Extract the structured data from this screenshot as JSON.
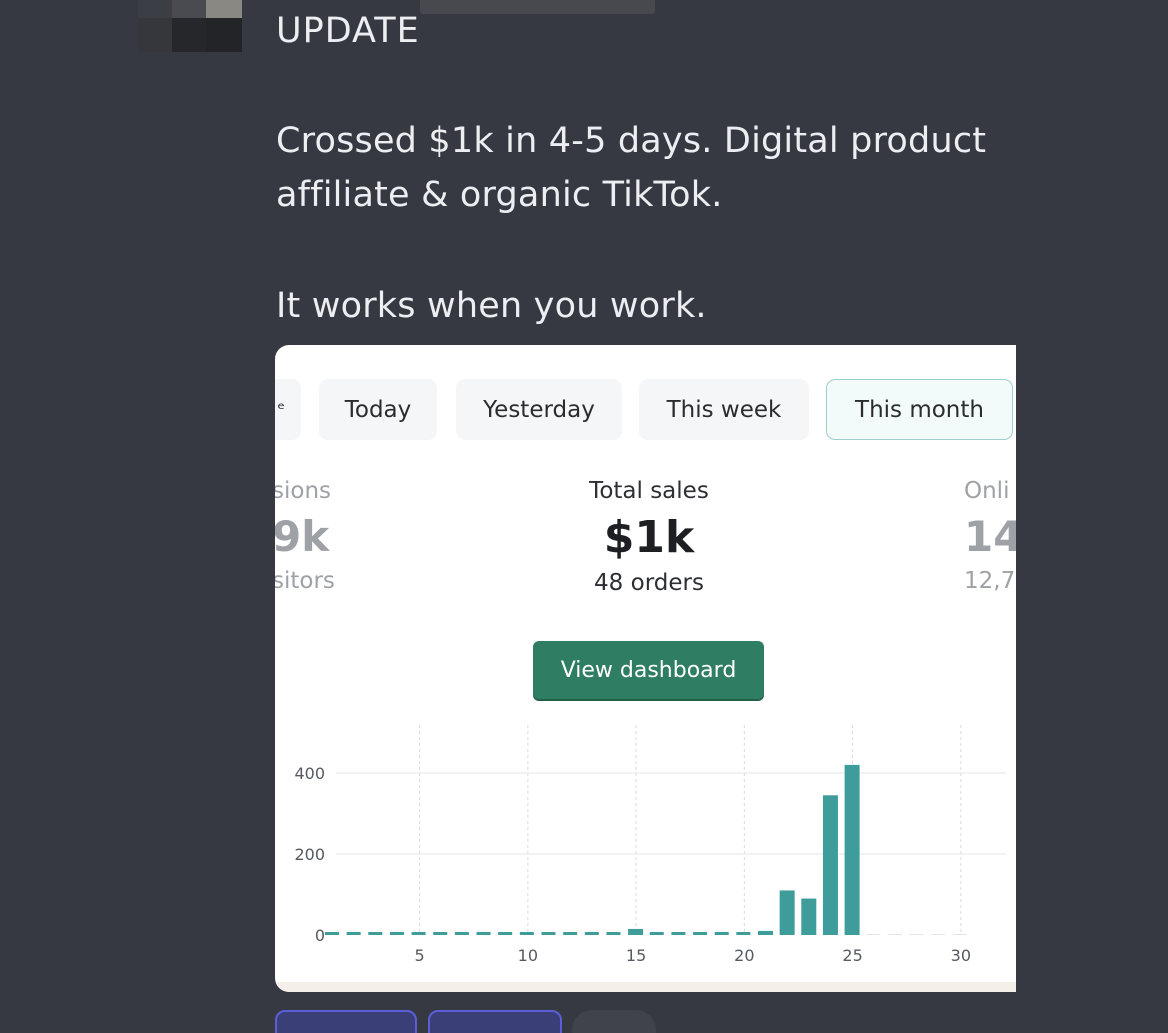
{
  "message": {
    "title": "UPDATE",
    "line1": "Crossed $1k in 4-5 days. Digital product",
    "line2": "affiliate & organic TikTok.",
    "line3": "It works when you work."
  },
  "card": {
    "tabs": [
      {
        "label": "Today"
      },
      {
        "label": "Yesterday"
      },
      {
        "label": "This week"
      },
      {
        "label": "This month",
        "active": true
      }
    ],
    "left_metric": {
      "label": "sions",
      "value": "9k",
      "sub": "sitors"
    },
    "center_metric": {
      "label": "Total sales",
      "value": "$1k",
      "sub": "48 orders"
    },
    "right_metric": {
      "label": "Onli",
      "value": "14",
      "sub": "12,7"
    },
    "dashboard_button": "View dashboard",
    "accent_color": "#2f7d62",
    "bar_color": "#3e9d9b"
  },
  "chart_data": {
    "type": "bar",
    "x": [
      1,
      2,
      3,
      4,
      5,
      6,
      7,
      8,
      9,
      10,
      11,
      12,
      13,
      14,
      15,
      16,
      17,
      18,
      19,
      20,
      21,
      22,
      23,
      24,
      25,
      26,
      27,
      28,
      29,
      30
    ],
    "values": [
      0,
      0,
      0,
      0,
      0,
      0,
      0,
      0,
      0,
      0,
      0,
      0,
      0,
      0,
      15,
      0,
      0,
      0,
      0,
      0,
      10,
      110,
      90,
      345,
      420,
      0,
      0,
      0,
      0,
      0
    ],
    "xticks": [
      "5",
      "10",
      "15",
      "20",
      "25",
      "30"
    ],
    "yticks": [
      "0",
      "200",
      "400"
    ],
    "ylim": [
      0,
      470
    ],
    "grid": true
  }
}
